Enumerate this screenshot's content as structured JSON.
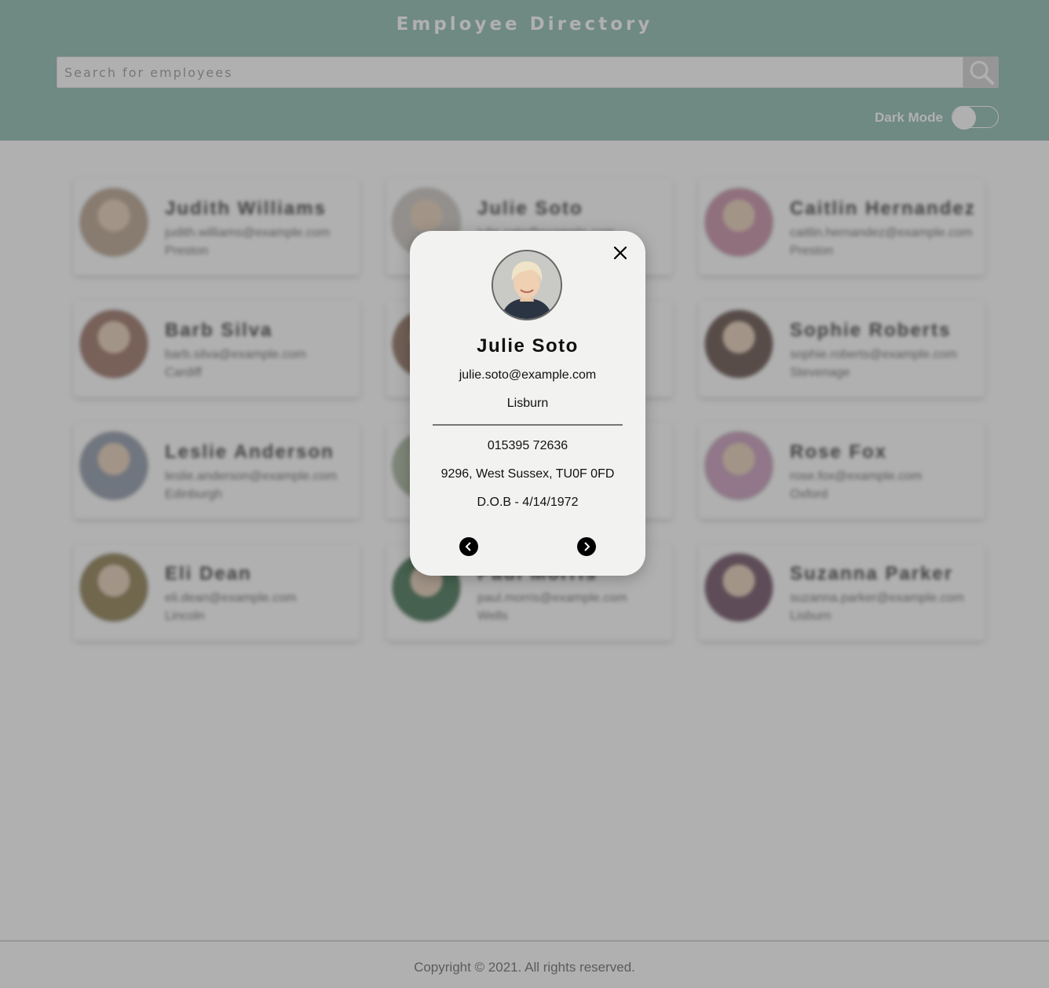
{
  "header": {
    "title": "Employee Directory",
    "search_placeholder": "Search for employees",
    "search_icon": "search-icon",
    "dark_mode_label": "Dark Mode",
    "dark_mode_enabled": false
  },
  "colors": {
    "header_bg": "#89b8ad",
    "overlay": "rgba(80,80,80,0.45)",
    "modal_bg": "#f2f2f1"
  },
  "employees": [
    {
      "name": "Judith Williams",
      "email": "judith.williams@example.com",
      "city": "Preston"
    },
    {
      "name": "Julie Soto",
      "email": "julie.soto@example.com",
      "city": "Lisburn"
    },
    {
      "name": "Caitlin Hernandez",
      "email": "caitlin.hernandez@example.com",
      "city": "Preston"
    },
    {
      "name": "Barb Silva",
      "email": "barb.silva@example.com",
      "city": "Cardiff"
    },
    {
      "name": "",
      "email": "",
      "city": ""
    },
    {
      "name": "Sophie Roberts",
      "email": "sophie.roberts@example.com",
      "city": "Stevenage"
    },
    {
      "name": "Leslie Anderson",
      "email": "leslie.anderson@example.com",
      "city": "Edinburgh"
    },
    {
      "name": "",
      "email": "",
      "city": ""
    },
    {
      "name": "Rose Fox",
      "email": "rose.fox@example.com",
      "city": "Oxford"
    },
    {
      "name": "Eli Dean",
      "email": "eli.dean@example.com",
      "city": "Lincoln"
    },
    {
      "name": "Paul Morris",
      "email": "paul.morris@example.com",
      "city": "Wells"
    },
    {
      "name": "Suzanna Parker",
      "email": "suzanna.parker@example.com",
      "city": "Lisburn"
    }
  ],
  "modal": {
    "name": "Julie Soto",
    "email": "julie.soto@example.com",
    "city": "Lisburn",
    "phone": "015395 72636",
    "address": "9296, West Sussex, TU0F 0FD",
    "dob": "D.O.B - 4/14/1972",
    "close_icon": "close-icon",
    "prev_icon": "chevron-left-icon",
    "next_icon": "chevron-right-icon"
  },
  "footer": {
    "copyright": "Copyright © 2021. All rights reserved."
  }
}
